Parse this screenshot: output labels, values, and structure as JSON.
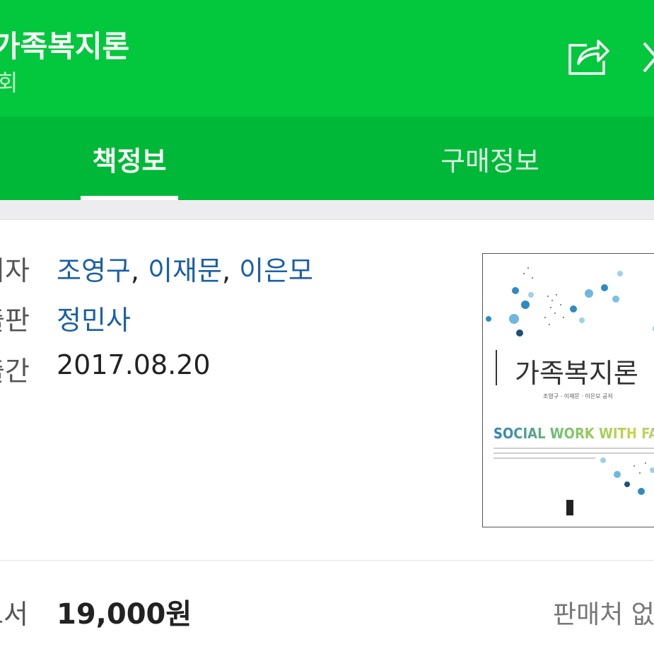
{
  "header": {
    "title": "가족복지론",
    "subtitle": "회"
  },
  "tabs": [
    {
      "label": "책정보",
      "active": true
    },
    {
      "label": "구매정보",
      "active": false
    }
  ],
  "info": {
    "author_label": "저자",
    "authors": [
      "조영구",
      "이재문",
      "이은모"
    ],
    "publisher_label": "출판",
    "publisher": "정민사",
    "date_label": "출간",
    "date": "2017.08.20"
  },
  "cover": {
    "title": "가족복지론",
    "authors": "조영구 · 이재문 · 이은모 공저",
    "english_title": "SOCIAL WORK WITH FAMILIES"
  },
  "price": {
    "label": "도서",
    "value": "19,000원",
    "seller": "판매처 없"
  },
  "colors": {
    "header_green": "#03c73c",
    "tab_green": "#00b838",
    "link_blue": "#1a5fa8"
  },
  "icons": [
    "share-icon",
    "close-icon"
  ]
}
